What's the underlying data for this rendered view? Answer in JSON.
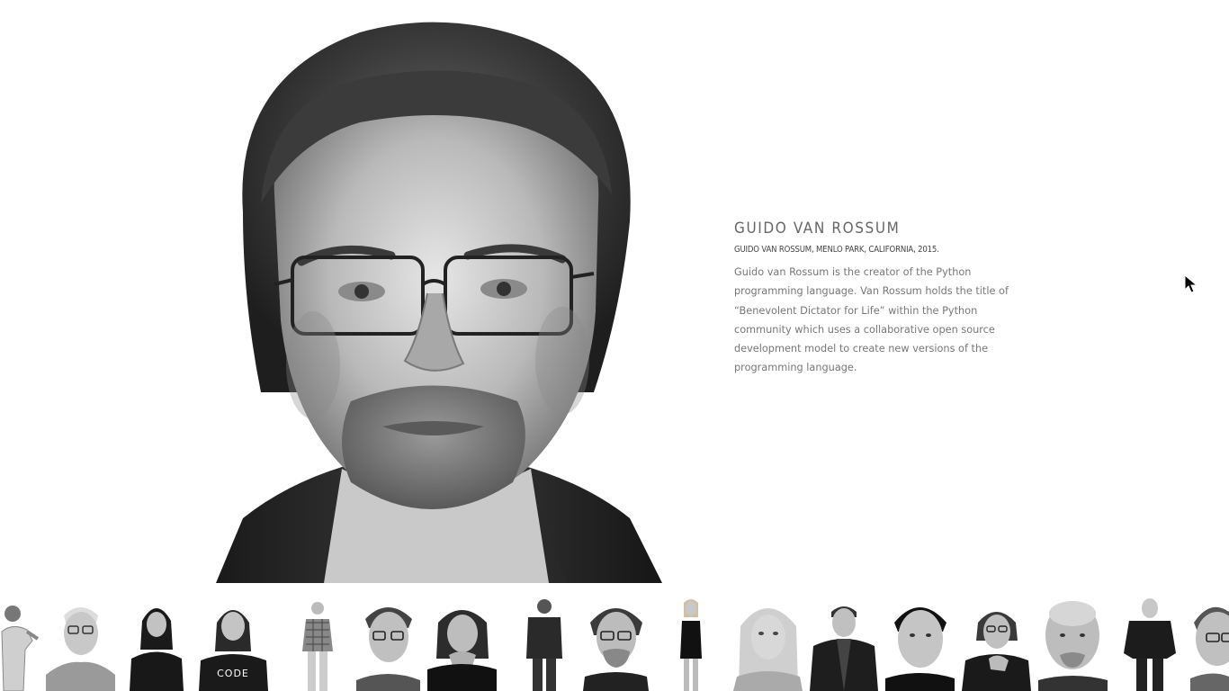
{
  "profile": {
    "name": "GUIDO VAN ROSSUM",
    "caption": "GUIDO VAN ROSSUM, MENLO PARK, CALIFORNIA, 2015.",
    "bio": "Guido van Rossum is the creator of the Python programming language. Van Rossum holds the title of “Benevolent Dictator for Life” within the Python community which uses a collaborative open source development model to create new versions of the programming language."
  },
  "colors": {
    "background": "#ffffff",
    "name_text": "#666666",
    "caption_text": "#444444",
    "bio_text": "#777777"
  },
  "thumbnails": [
    {
      "id": "thumb-1",
      "kind": "full-body-figure"
    },
    {
      "id": "thumb-2",
      "kind": "headshot-elderly-man-glasses"
    },
    {
      "id": "thumb-3",
      "kind": "half-body-woman-dark-hair"
    },
    {
      "id": "thumb-4",
      "kind": "half-body-woman-code-shirt"
    },
    {
      "id": "thumb-5",
      "kind": "full-body-man-plaid-shirt"
    },
    {
      "id": "thumb-6",
      "kind": "headshot-elderly-man-glasses"
    },
    {
      "id": "thumb-7",
      "kind": "headshot-woman-hand-on-chin"
    },
    {
      "id": "thumb-8",
      "kind": "full-body-man-dark-shirt"
    },
    {
      "id": "thumb-9",
      "kind": "headshot-man-glasses-beard"
    },
    {
      "id": "thumb-10",
      "kind": "full-body-woman-black-dress"
    },
    {
      "id": "thumb-11",
      "kind": "headshot-blonde-woman"
    },
    {
      "id": "thumb-12",
      "kind": "half-body-man-jacket"
    },
    {
      "id": "thumb-13",
      "kind": "headshot-man-round-face"
    },
    {
      "id": "thumb-14",
      "kind": "half-body-woman-glasses"
    },
    {
      "id": "thumb-15",
      "kind": "headshot-bald-man"
    },
    {
      "id": "thumb-16",
      "kind": "full-body-bald-man-jacket"
    },
    {
      "id": "thumb-17",
      "kind": "headshot-man-glasses-partial"
    }
  ]
}
